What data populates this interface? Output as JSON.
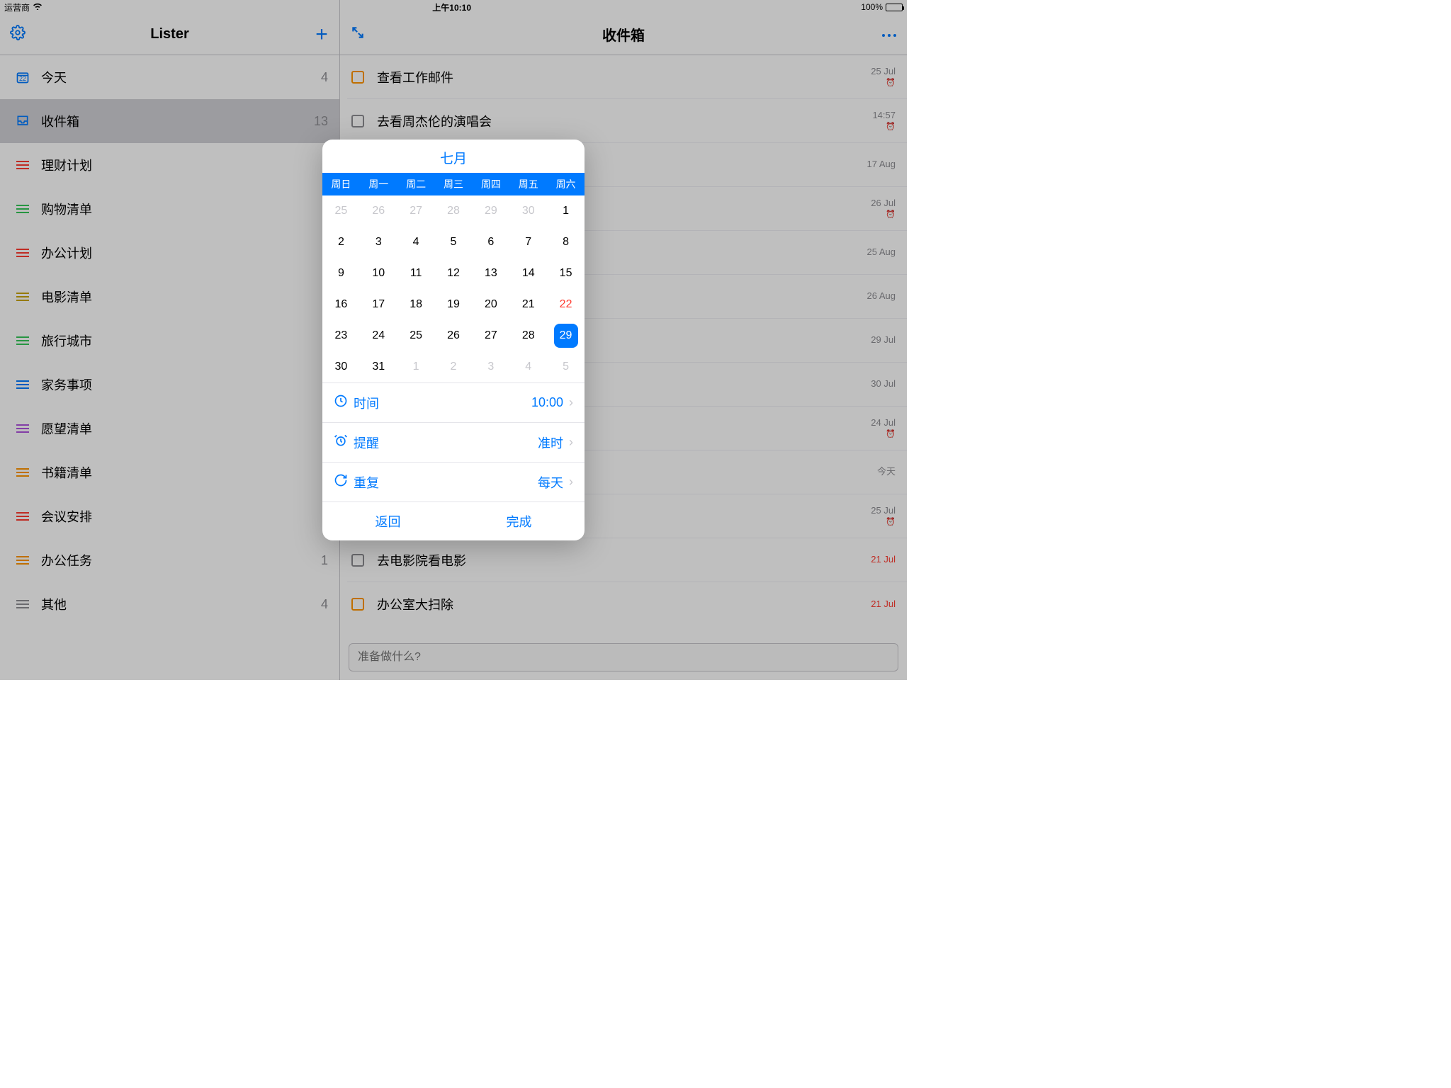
{
  "status": {
    "carrier": "运营商",
    "time": "上午10:10",
    "battery": "100%"
  },
  "sidebar": {
    "title": "Lister",
    "items": [
      {
        "label": "今天",
        "count": "4",
        "icon": "calendar",
        "color": "#007aff"
      },
      {
        "label": "收件箱",
        "count": "13",
        "icon": "inbox",
        "color": "#007aff"
      },
      {
        "label": "理财计划",
        "count": "",
        "icon": "lines",
        "color": "#ff3b30"
      },
      {
        "label": "购物清单",
        "count": "",
        "icon": "lines",
        "color": "#34c759"
      },
      {
        "label": "办公计划",
        "count": "",
        "icon": "lines",
        "color": "#ff3b30"
      },
      {
        "label": "电影清单",
        "count": "",
        "icon": "lines",
        "color": "#c9a50b"
      },
      {
        "label": "旅行城市",
        "count": "",
        "icon": "lines",
        "color": "#34c759"
      },
      {
        "label": "家务事项",
        "count": "",
        "icon": "lines",
        "color": "#007aff"
      },
      {
        "label": "愿望清单",
        "count": "",
        "icon": "lines",
        "color": "#af52de"
      },
      {
        "label": "书籍清单",
        "count": "",
        "icon": "lines",
        "color": "#ff9500"
      },
      {
        "label": "会议安排",
        "count": "",
        "icon": "lines",
        "color": "#ff3b30"
      },
      {
        "label": "办公任务",
        "count": "1",
        "icon": "lines",
        "color": "#ff9500"
      },
      {
        "label": "其他",
        "count": "4",
        "icon": "lines",
        "color": "#8e8e93"
      }
    ]
  },
  "main": {
    "title": "收件箱",
    "input_placeholder": "准备做什么?",
    "tasks": [
      {
        "text": "查看工作邮件",
        "color": "#ff9500",
        "meta1": "25 Jul",
        "alarm": true
      },
      {
        "text": "去看周杰伦的演唱会",
        "color": "#8e8e93",
        "meta1": "14:57",
        "alarm": true
      },
      {
        "text": "",
        "color": "",
        "meta1": "17 Aug",
        "alarm": false
      },
      {
        "text": "",
        "color": "",
        "meta1": "26 Jul",
        "alarm": true
      },
      {
        "text": "",
        "color": "",
        "meta1": "25 Aug",
        "alarm": false
      },
      {
        "text": "",
        "color": "",
        "meta1": "26 Aug",
        "alarm": false
      },
      {
        "text": "",
        "color": "",
        "meta1": "29 Jul",
        "alarm": false
      },
      {
        "text": "",
        "color": "",
        "meta1": "30 Jul",
        "alarm": false
      },
      {
        "text": "",
        "color": "",
        "meta1": "24 Jul",
        "alarm": true
      },
      {
        "text": "",
        "color": "",
        "meta1": "今天",
        "alarm": false
      },
      {
        "text": "",
        "color": "",
        "meta1": "25 Jul",
        "alarm": true
      },
      {
        "text": "去电影院看电影",
        "color": "#8e8e93",
        "meta1": "21 Jul",
        "alarm": false,
        "red": true
      },
      {
        "text": "办公室大扫除",
        "color": "#ff9500",
        "meta1": "21 Jul",
        "alarm": false,
        "red": true
      }
    ]
  },
  "popover": {
    "month": "七月",
    "weekdays": [
      "周日",
      "周一",
      "周二",
      "周三",
      "周四",
      "周五",
      "周六"
    ],
    "days": [
      {
        "n": "25",
        "o": true
      },
      {
        "n": "26",
        "o": true
      },
      {
        "n": "27",
        "o": true
      },
      {
        "n": "28",
        "o": true
      },
      {
        "n": "29",
        "o": true
      },
      {
        "n": "30",
        "o": true
      },
      {
        "n": "1"
      },
      {
        "n": "2"
      },
      {
        "n": "3"
      },
      {
        "n": "4"
      },
      {
        "n": "5"
      },
      {
        "n": "6"
      },
      {
        "n": "7"
      },
      {
        "n": "8"
      },
      {
        "n": "9"
      },
      {
        "n": "10"
      },
      {
        "n": "11"
      },
      {
        "n": "12"
      },
      {
        "n": "13"
      },
      {
        "n": "14"
      },
      {
        "n": "15"
      },
      {
        "n": "16"
      },
      {
        "n": "17"
      },
      {
        "n": "18"
      },
      {
        "n": "19"
      },
      {
        "n": "20"
      },
      {
        "n": "21"
      },
      {
        "n": "22",
        "r": true
      },
      {
        "n": "23"
      },
      {
        "n": "24"
      },
      {
        "n": "25"
      },
      {
        "n": "26"
      },
      {
        "n": "27"
      },
      {
        "n": "28"
      },
      {
        "n": "29",
        "s": true
      },
      {
        "n": "30"
      },
      {
        "n": "31"
      },
      {
        "n": "1",
        "o": true
      },
      {
        "n": "2",
        "o": true
      },
      {
        "n": "3",
        "o": true
      },
      {
        "n": "4",
        "o": true
      },
      {
        "n": "5",
        "o": true
      }
    ],
    "rows": {
      "time_label": "时间",
      "time_value": "10:00",
      "remind_label": "提醒",
      "remind_value": "准时",
      "repeat_label": "重复",
      "repeat_value": "每天"
    },
    "back": "返回",
    "done": "完成"
  }
}
